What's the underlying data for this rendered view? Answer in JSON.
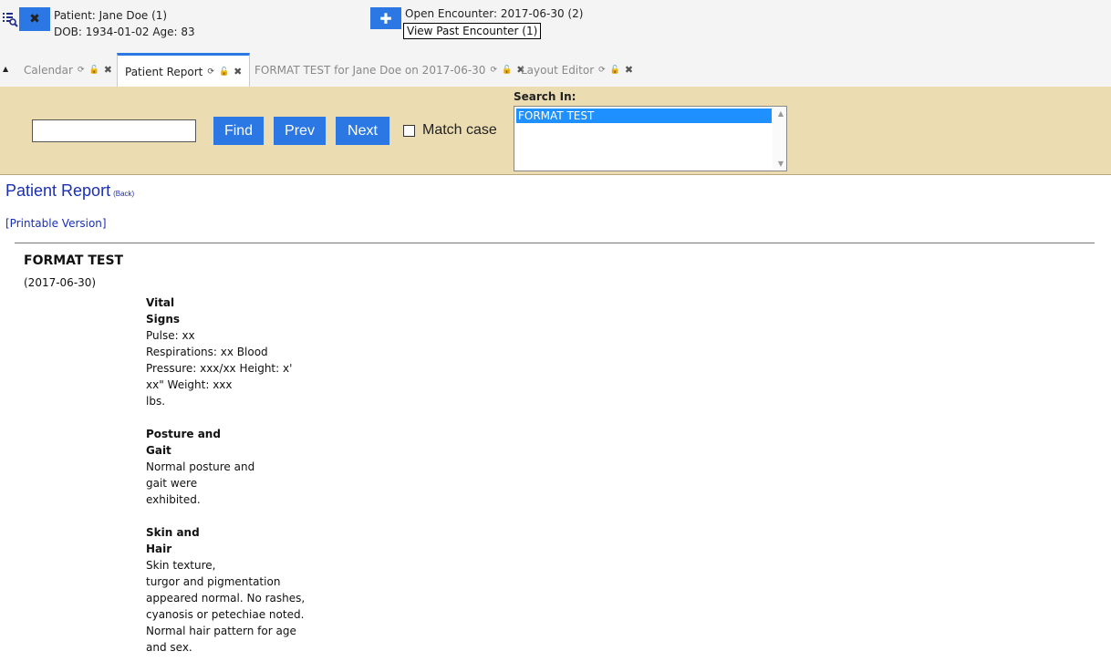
{
  "header": {
    "patient_label": "Patient: Jane Doe (1)",
    "dob_label": "DOB: 1934-01-02 Age: 83",
    "open_encounter": "Open Encounter: 2017-06-30 (2)",
    "past_encounter": "View Past Encounter (1)",
    "close_glyph": "✖",
    "add_glyph": "✚"
  },
  "tabs": [
    {
      "label": "Calendar",
      "active": false
    },
    {
      "label": "Patient Report",
      "active": true
    },
    {
      "label": "FORMAT TEST for Jane Doe on 2017-06-30",
      "active": false
    },
    {
      "label": "Layout Editor",
      "active": false
    }
  ],
  "tab_icons": {
    "refresh": "⟳",
    "lock": "🔓",
    "close": "✖",
    "collapse": "▲"
  },
  "search": {
    "input_value": "",
    "find_label": "Find",
    "prev_label": "Prev",
    "next_label": "Next",
    "match_case_label": "Match case",
    "search_in_label": "Search In:",
    "search_in_options": [
      "FORMAT TEST"
    ]
  },
  "report": {
    "title": "Patient Report",
    "back_label": "(Back)",
    "printable_label": "[Printable Version]",
    "form_title": "FORMAT TEST",
    "form_date": "(2017-06-30)",
    "sections": [
      {
        "head_1": "Vital",
        "head_2": "Signs",
        "lines": [
          "Pulse: xx",
          "Respirations: xx Blood",
          "Pressure: xxx/xx Height: x'",
          "xx\" Weight: xxx",
          "lbs."
        ]
      },
      {
        "head_1": "Posture and",
        "head_2": "Gait",
        "lines": [
          "Normal posture and",
          "gait were",
          "exhibited."
        ]
      },
      {
        "head_1": "Skin and",
        "head_2": "Hair",
        "lines": [
          "Skin texture,",
          "turgor and pigmentation",
          "appeared normal. No rashes,",
          "cyanosis or petechiae noted.",
          "Normal hair pattern for age",
          "and sex."
        ]
      }
    ]
  },
  "colors": {
    "accent": "#2b78e4",
    "search_bg": "#ebdcb2",
    "link": "#1a2fb3"
  }
}
